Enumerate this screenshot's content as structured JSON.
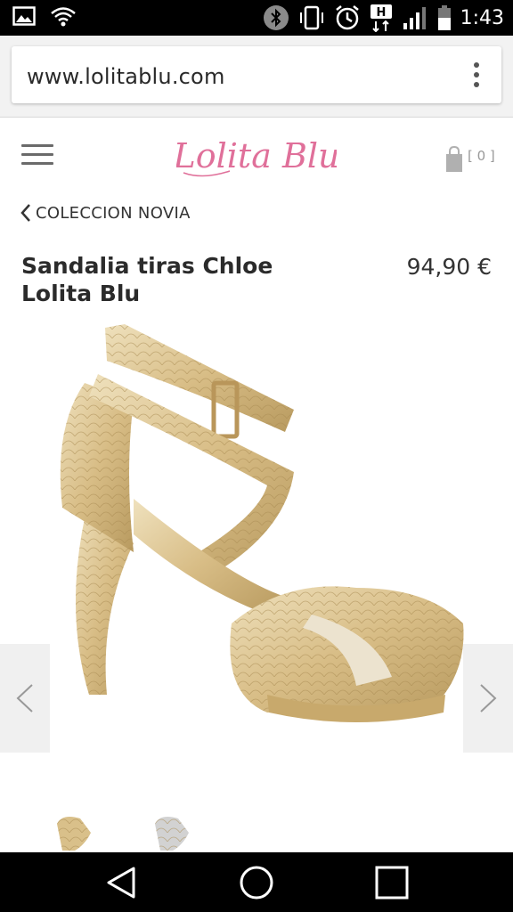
{
  "status_bar": {
    "time": "1:43",
    "icons": [
      "image-icon",
      "wifi-icon",
      "bluetooth-icon",
      "vibrate-icon",
      "alarm-icon",
      "hplus-icon",
      "signal-icon",
      "battery-icon"
    ]
  },
  "browser": {
    "url": "www.lolitablu.com",
    "menu_icon": "kebab-menu-icon"
  },
  "header": {
    "menu_icon": "hamburger-icon",
    "logo_text": "Lolita Blu",
    "cart_icon": "shopping-bag-icon",
    "cart_count": "[ 0 ]"
  },
  "breadcrumb": {
    "icon": "chevron-left-icon",
    "label": "COLECCION NOVIA"
  },
  "product": {
    "title": "Sandalia tiras Chloe Lolita Blu",
    "price": "94,90 €"
  },
  "gallery": {
    "prev_icon": "chevron-left-icon",
    "next_icon": "chevron-right-icon",
    "thumbnail_count": 2
  },
  "nav_bar": {
    "back_icon": "back-triangle-icon",
    "home_icon": "home-circle-icon",
    "recents_icon": "recents-square-icon"
  },
  "colors": {
    "logo_pink": "#e0709a",
    "gold": "#d9c08a",
    "text_dark": "#2b2b2b"
  }
}
